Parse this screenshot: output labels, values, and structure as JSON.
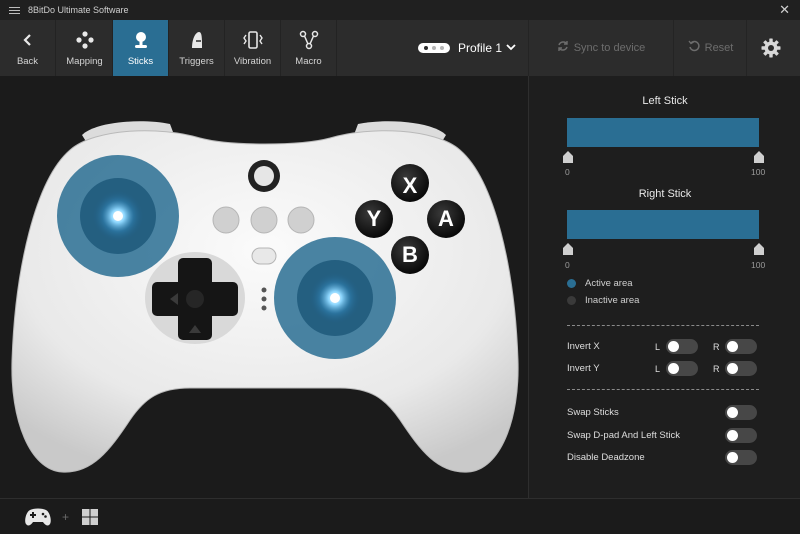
{
  "window": {
    "title": "8BitDo Ultimate Software",
    "close_glyph": "✕"
  },
  "toolbar": {
    "tabs": [
      {
        "label": "Back",
        "icon": "chevron-left-icon"
      },
      {
        "label": "Mapping",
        "icon": "dpad-dots-icon"
      },
      {
        "label": "Sticks",
        "icon": "joystick-icon",
        "active": true
      },
      {
        "label": "Triggers",
        "icon": "trigger-icon"
      },
      {
        "label": "Vibration",
        "icon": "vibration-icon"
      },
      {
        "label": "Macro",
        "icon": "macro-icon"
      }
    ],
    "profile": {
      "name": "Profile 1",
      "chevron": "⌄"
    },
    "sync_label": "Sync to device",
    "reset_label": "Reset"
  },
  "controller": {
    "face_buttons": [
      "X",
      "Y",
      "A",
      "B"
    ]
  },
  "panel": {
    "left_stick": {
      "title": "Left Stick",
      "min": "0",
      "max": "100"
    },
    "right_stick": {
      "title": "Right Stick",
      "min": "0",
      "max": "100"
    },
    "legend": {
      "active": "Active area",
      "inactive": "Inactive area"
    },
    "invert_x": {
      "label": "Invert X",
      "l": "L",
      "r": "R"
    },
    "invert_y": {
      "label": "Invert Y",
      "l": "L",
      "r": "R"
    },
    "swap_sticks": "Swap Sticks",
    "swap_dpad": "Swap D-pad And Left Stick",
    "disable_deadzone": "Disable Deadzone"
  },
  "footer": {
    "plus": "+"
  },
  "colors": {
    "accent": "#2a6e93",
    "inactive_dot": "#3a3a3a",
    "active_dot": "#2a6e93"
  }
}
